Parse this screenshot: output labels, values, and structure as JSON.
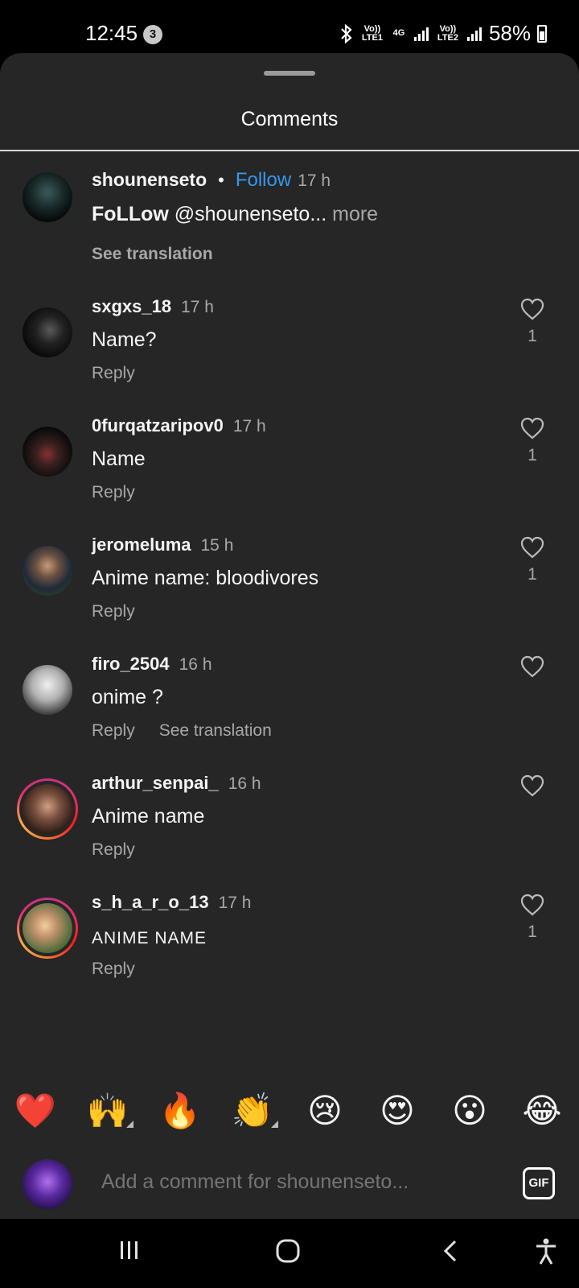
{
  "status_bar": {
    "time": "12:45",
    "notification_count": "3",
    "network_1": "Vo)) LTE1",
    "network_type": "4G",
    "network_2": "Vo)) LTE2",
    "battery_percent": "58%"
  },
  "sheet": {
    "title": "Comments"
  },
  "caption": {
    "username": "shounenseto",
    "follow_label": "Follow",
    "time": "17 h",
    "text_bold": "FoLLow",
    "text_rest": "@shounenseto...",
    "more_label": "more",
    "see_translation": "See translation"
  },
  "comments": [
    {
      "username": "sxgxs_18",
      "time": "17 h",
      "text": "Name?",
      "reply": "Reply",
      "likes": "1"
    },
    {
      "username": "0furqatzaripov0",
      "time": "17 h",
      "text": "Name",
      "reply": "Reply",
      "likes": "1"
    },
    {
      "username": "jeromeluma",
      "time": "15 h",
      "text": "Anime name: bloodivores",
      "reply": "Reply",
      "likes": "1"
    },
    {
      "username": "firo_2504",
      "time": "16 h",
      "text": "onime ?",
      "reply": "Reply",
      "see_translation": "See translation",
      "likes": ""
    },
    {
      "username": "arthur_senpai_",
      "time": "16 h",
      "text": "Anime name",
      "reply": "Reply",
      "likes": ""
    },
    {
      "username": "s_h_a_r_o_13",
      "time": "17 h",
      "text": "ANIME NAME",
      "reply": "Reply",
      "likes": "1"
    }
  ],
  "emoji_bar": [
    "❤️",
    "🙌",
    "🔥",
    "👏",
    "😢",
    "😍",
    "😮",
    "😂"
  ],
  "input": {
    "placeholder": "Add a comment for shounenseto...",
    "gif_label": "GIF"
  },
  "colors": {
    "sheet_bg": "#262626",
    "accent_blue": "#3797f0",
    "secondary_text": "#a8a8a8"
  }
}
